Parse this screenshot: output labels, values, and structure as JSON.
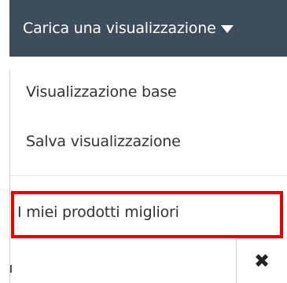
{
  "toolbar": {
    "load_view_label": "Carica una visualizzazione"
  },
  "menu": {
    "items": [
      {
        "label": "Visualizzazione base"
      },
      {
        "label": "Salva visualizzazione"
      },
      {
        "label": "I miei prodotti migliori",
        "highlighted": true
      }
    ],
    "close_icon": "✖"
  },
  "colors": {
    "button_background": "#3e4d5c",
    "button_text": "#ffffff",
    "highlight_border": "#e60000"
  }
}
